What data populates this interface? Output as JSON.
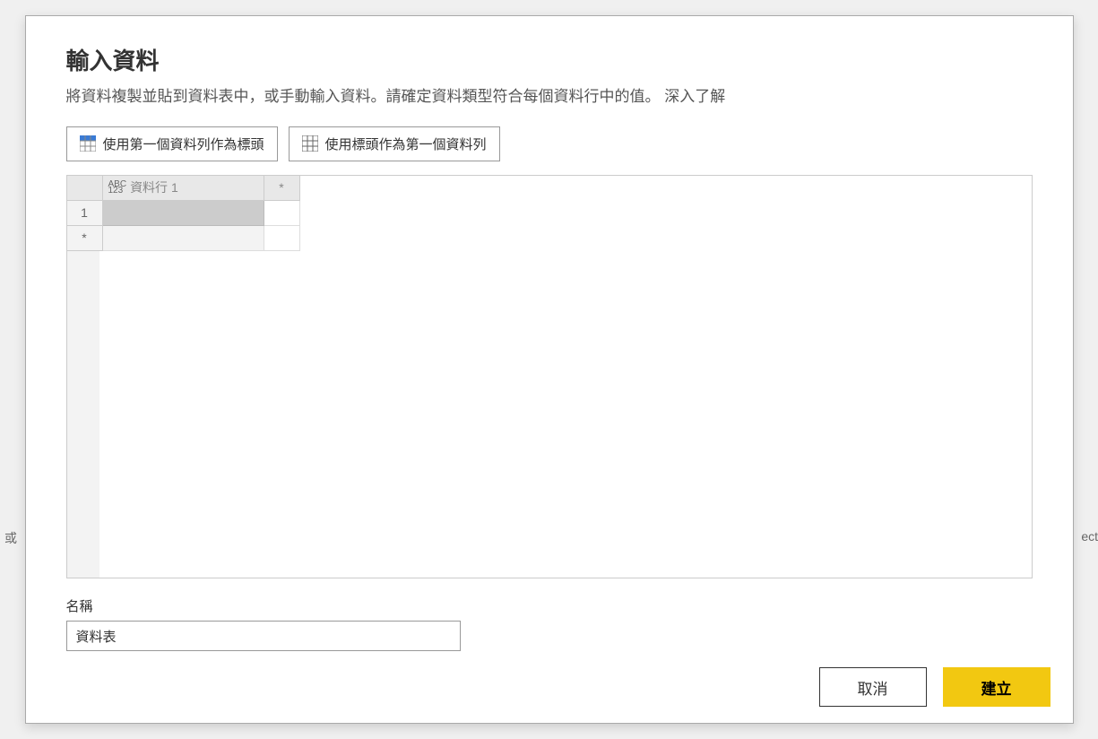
{
  "background": {
    "left_fragment": "或",
    "right_fragment": "ect"
  },
  "dialog": {
    "title": "輸入資料",
    "subtitle_main": "將資料複製並貼到資料表中，或手動輸入資料。請確定資料類型符合每個資料行中的值。",
    "subtitle_link": "深入了解",
    "toolbar": {
      "use_first_row_as_header": "使用第一個資料列作為標頭",
      "use_header_as_first_row": "使用標頭作為第一個資料列"
    },
    "grid": {
      "column_type_label_top": "ABC",
      "column_type_label_bottom": "123",
      "column1_name": "資料行 1",
      "new_col_marker": "*",
      "row1_label": "1",
      "new_row_marker": "*"
    },
    "name_section": {
      "label": "名稱",
      "value": "資料表"
    },
    "footer": {
      "cancel": "取消",
      "create": "建立"
    }
  }
}
